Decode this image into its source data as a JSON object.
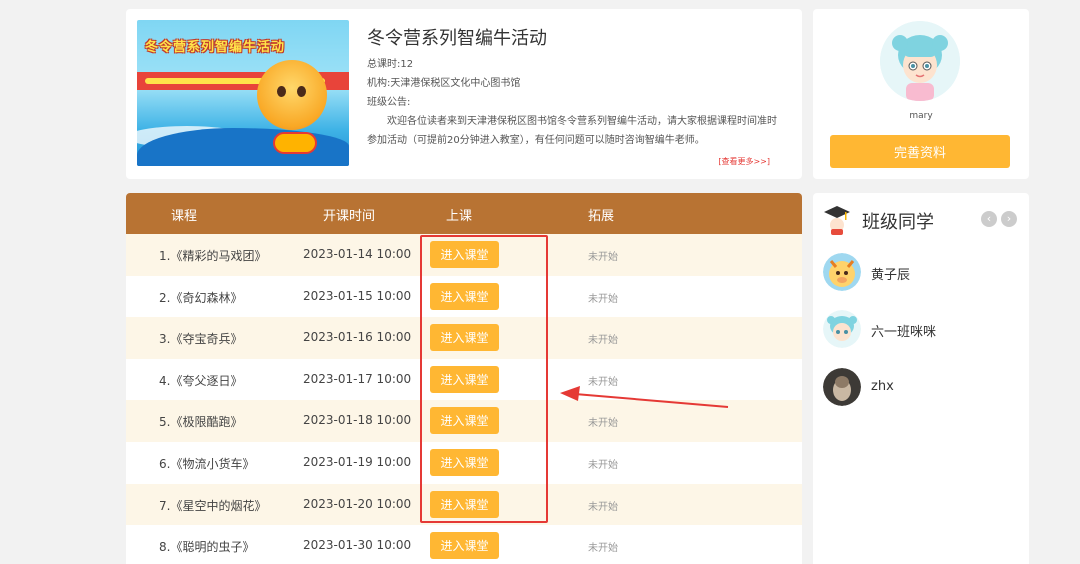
{
  "course": {
    "banner_title": "冬令营系列智编牛活动",
    "banner_badge": "智编牛",
    "title": "冬令营系列智编牛活动",
    "total_hours": "总课时:12",
    "institution": "机构:天津港保税区文化中心图书馆",
    "notice_label": "班级公告:",
    "notice_text": "欢迎各位读者来到天津港保税区图书馆冬令营系列智编牛活动，请大家根据课程时间准时参加活动（可提前20分钟进入教室），有任何问题可以随时咨询智编牛老师。",
    "more_link": "[查看更多>>]"
  },
  "table": {
    "headers": [
      "课程",
      "开课时间",
      "上课",
      "拓展"
    ],
    "rows": [
      {
        "name": "1.《精彩的马戏团》",
        "time": "2023-01-14 10:00",
        "button": "进入课堂",
        "ext": "未开始"
      },
      {
        "name": "2.《奇幻森林》",
        "time": "2023-01-15 10:00",
        "button": "进入课堂",
        "ext": "未开始"
      },
      {
        "name": "3.《夺宝奇兵》",
        "time": "2023-01-16 10:00",
        "button": "进入课堂",
        "ext": "未开始"
      },
      {
        "name": "4.《夸父逐日》",
        "time": "2023-01-17 10:00",
        "button": "进入课堂",
        "ext": "未开始"
      },
      {
        "name": "5.《极限酷跑》",
        "time": "2023-01-18 10:00",
        "button": "进入课堂",
        "ext": "未开始"
      },
      {
        "name": "6.《物流小货车》",
        "time": "2023-01-19 10:00",
        "button": "进入课堂",
        "ext": "未开始"
      },
      {
        "name": "7.《星空中的烟花》",
        "time": "2023-01-20 10:00",
        "button": "进入课堂",
        "ext": "未开始"
      },
      {
        "name": "8.《聪明的虫子》",
        "time": "2023-01-30 10:00",
        "button": "进入课堂",
        "ext": "未开始"
      }
    ]
  },
  "profile": {
    "username": "mary",
    "complete_button": "完善资料"
  },
  "classmates": {
    "title": "班级同学",
    "prev_icon": "‹",
    "next_icon": "›",
    "list": [
      {
        "name": "黄子辰"
      },
      {
        "name": "六一班咪咪"
      },
      {
        "name": "zhx"
      }
    ]
  },
  "colors": {
    "header_bg": "#b87333",
    "accent": "#ffb733",
    "highlight": "#e53935"
  }
}
